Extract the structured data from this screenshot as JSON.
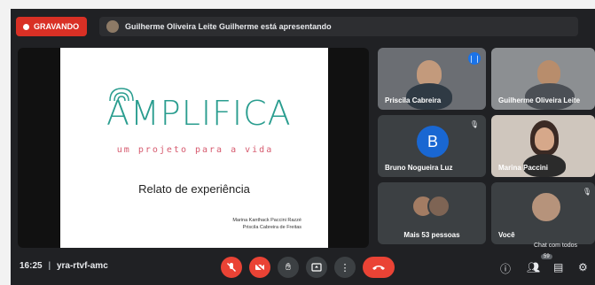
{
  "recording": {
    "label": "GRAVANDO",
    "color": "#d93025"
  },
  "presentation_banner": {
    "text": "Guilherme Oliveira Leite Guilherme está apresentando"
  },
  "slide": {
    "logo_text": "AMPLIFICA",
    "tagline": "um projeto para a vida",
    "heading": "Relato de experiência",
    "authors": [
      "Marina Kanthack Paccini Razzé",
      "Priscila Cabreira de Freitas"
    ]
  },
  "participants": [
    {
      "name": "Priscila Cabreira",
      "status_icon": "speaking-icon"
    },
    {
      "name": "Guilherme Oliveira Leite"
    },
    {
      "name": "Bruno Nogueira Luz",
      "initial": "B",
      "status_icon": "mic-off-icon"
    },
    {
      "name": "Marina Paccini"
    },
    {
      "name": "Mais 53 pessoas"
    },
    {
      "name": "Você",
      "status_icon": "mic-off-icon"
    }
  ],
  "toolbar": {
    "time": "16:25",
    "meeting_code": "yra-rtvf-amc",
    "chat_hint": "Chat com todos",
    "people_count": "59"
  },
  "colors": {
    "accent": "#1a73e8",
    "danger": "#ea4335",
    "background": "#202124"
  }
}
